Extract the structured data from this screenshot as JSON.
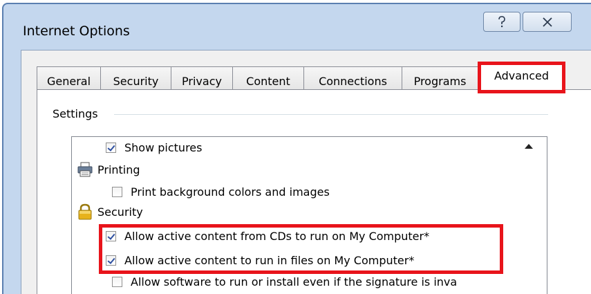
{
  "window": {
    "title": "Internet Options",
    "help_glyph": "?",
    "close_glyph": "X"
  },
  "tabs": [
    {
      "label": "General"
    },
    {
      "label": "Security"
    },
    {
      "label": "Privacy"
    },
    {
      "label": "Content"
    },
    {
      "label": "Connections"
    },
    {
      "label": "Programs"
    },
    {
      "label": "Advanced",
      "active": true
    }
  ],
  "settings": {
    "group_label": "Settings",
    "items": [
      {
        "type": "checkbox",
        "label": "Show pictures",
        "checked": true
      },
      {
        "type": "category",
        "label": "Printing",
        "icon": "printer-icon"
      },
      {
        "type": "checkbox",
        "label": "Print background colors and images",
        "checked": false
      },
      {
        "type": "category",
        "label": "Security",
        "icon": "padlock-icon"
      },
      {
        "type": "checkbox",
        "label": "Allow active content from CDs to run on My Computer*",
        "checked": true
      },
      {
        "type": "checkbox",
        "label": "Allow active content to run in files on My Computer*",
        "checked": true
      },
      {
        "type": "checkbox",
        "label": "Allow software to run or install even if the signature is inva",
        "checked": false
      }
    ]
  },
  "colors": {
    "highlight": "#e8141b",
    "frame": "#c4d7ee",
    "checkmark": "#2d4fa0"
  }
}
